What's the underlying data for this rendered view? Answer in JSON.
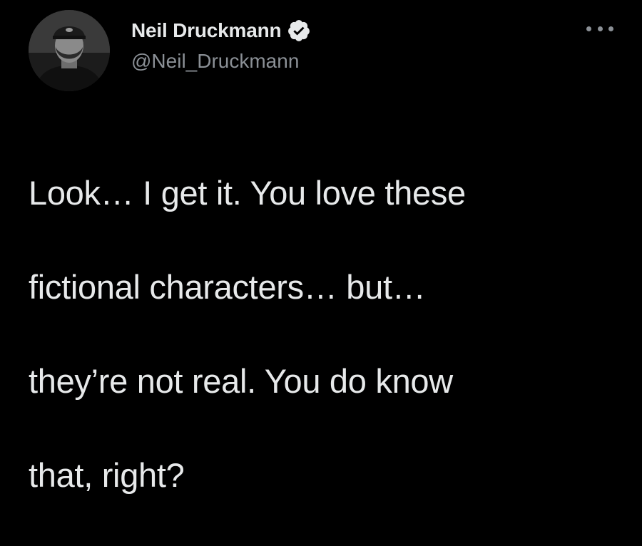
{
  "tweet": {
    "author": {
      "display_name": "Neil Druckmann",
      "handle": "@Neil_Druckmann",
      "verified": true,
      "avatar_icon": "user-avatar"
    },
    "more_icon": "more-options-icon",
    "text_lines": [
      "Look… I get it. You love these",
      "fictional characters… but…",
      "they’re not real. You do know",
      "that, right?"
    ]
  },
  "colors": {
    "background": "#000000",
    "text_primary": "#e7e9ea",
    "text_secondary": "#8b9096",
    "verified_badge": "#e7e9ea"
  }
}
